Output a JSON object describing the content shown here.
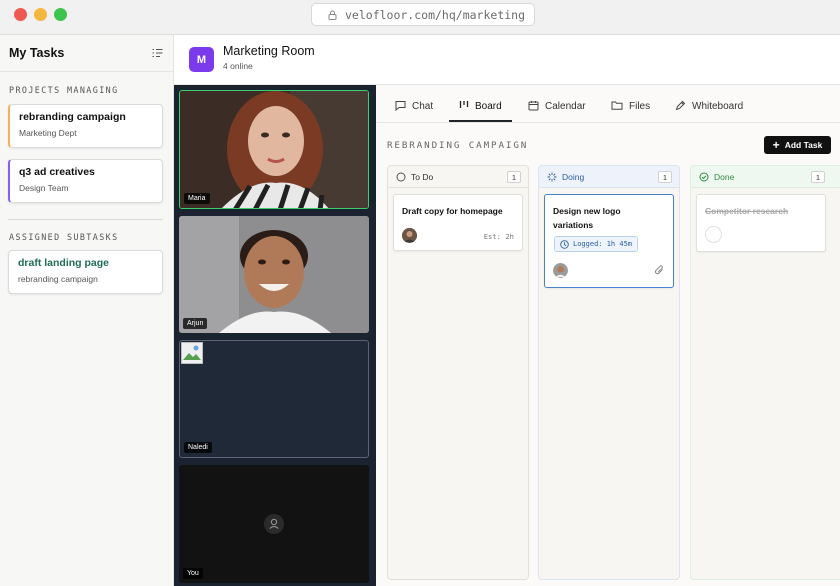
{
  "browser": {
    "url": "velofloor.com/hq/marketing"
  },
  "sidebar": {
    "title": "My Tasks",
    "projects_heading": "PROJECTS MANAGING",
    "projects": [
      {
        "title": "rebranding campaign",
        "subtitle": "Marketing Dept",
        "accent": "#f0b35b"
      },
      {
        "title": "q3 ad creatives",
        "subtitle": "Design Team",
        "accent": "#8b5cf6"
      }
    ],
    "subtasks_heading": "ASSIGNED SUBTASKS",
    "subtasks": [
      {
        "title": "draft landing page",
        "subtitle": "rebranding campaign",
        "color": "#1f6d54"
      }
    ]
  },
  "room": {
    "avatar_letter": "M",
    "title": "Marketing Room",
    "status": "4 online",
    "avatar_color": "#7c3aed"
  },
  "video": {
    "participants": [
      {
        "name": "Maria"
      },
      {
        "name": "Arjun"
      },
      {
        "name": "Naledi"
      },
      {
        "name": "You"
      }
    ]
  },
  "tabs": [
    {
      "label": "Chat",
      "icon": "chat-icon"
    },
    {
      "label": "Board",
      "icon": "board-icon",
      "active": true
    },
    {
      "label": "Calendar",
      "icon": "calendar-icon"
    },
    {
      "label": "Files",
      "icon": "folder-icon"
    },
    {
      "label": "Whiteboard",
      "icon": "pen-icon"
    }
  ],
  "board": {
    "title": "REBRANDING CAMPAIGN",
    "add_task_label": "Add Task",
    "columns": [
      {
        "name": "To Do",
        "count": "1",
        "cards": [
          {
            "title": "Draft copy for homepage",
            "estimate": "Est: 2h"
          }
        ]
      },
      {
        "name": "Doing",
        "count": "1",
        "cards": [
          {
            "title": "Design new logo variations",
            "logged": "Logged: 1h 45m"
          }
        ]
      },
      {
        "name": "Done",
        "count": "1",
        "cards": [
          {
            "title": "Competitor research"
          }
        ]
      }
    ]
  }
}
